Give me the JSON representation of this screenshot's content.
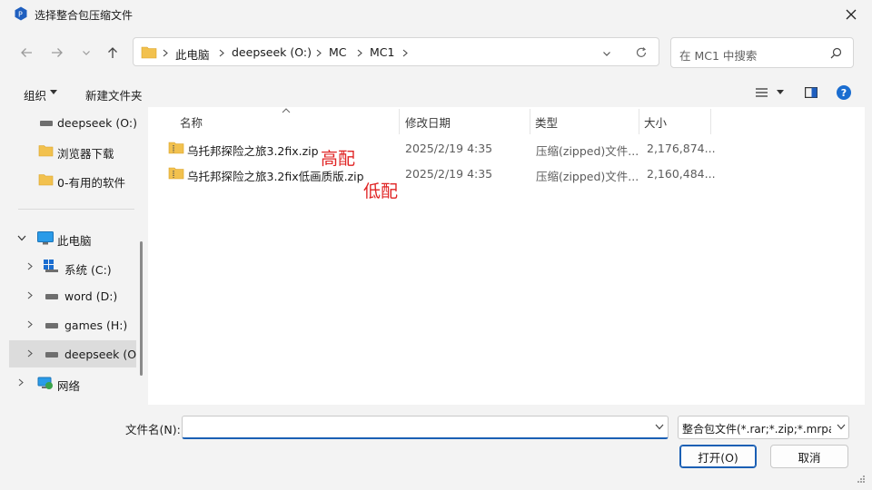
{
  "window": {
    "title": "选择整合包压缩文件"
  },
  "address": {
    "crumbs": [
      "此电脑",
      "deepseek (O:)",
      "MC",
      "MC1"
    ]
  },
  "search": {
    "placeholder": "在 MC1 中搜索"
  },
  "toolbar": {
    "organize": "组织",
    "new_folder": "新建文件夹"
  },
  "sidebar": {
    "items": [
      {
        "label": "deepseek (O:)"
      },
      {
        "label": "浏览器下载"
      },
      {
        "label": "0-有用的软件"
      },
      {
        "label": "此电脑"
      },
      {
        "label": "系统 (C:)"
      },
      {
        "label": "word (D:)"
      },
      {
        "label": "games (H:)"
      },
      {
        "label": "deepseek (O"
      },
      {
        "label": "网络"
      }
    ]
  },
  "columns": {
    "name": "名称",
    "modified": "修改日期",
    "type": "类型",
    "size": "大小"
  },
  "files": [
    {
      "name": "乌托邦探险之旅3.2fix.zip",
      "modified": "2025/2/19 4:35",
      "type": "压缩(zipped)文件...",
      "size": "2,176,874..."
    },
    {
      "name": "乌托邦探险之旅3.2fix低画质版.zip",
      "modified": "2025/2/19 4:35",
      "type": "压缩(zipped)文件...",
      "size": "2,160,484..."
    }
  ],
  "annotations": {
    "high": "高配",
    "low": "低配"
  },
  "footer": {
    "filename_label": "文件名(N):",
    "filename_value": "",
    "filter": "整合包文件(*.rar;*.zip;*.mrpac",
    "open": "打开(O)",
    "cancel": "取消"
  },
  "colors": {
    "accent": "#1a5fb4",
    "annotation": "#e02424",
    "folder": "#f2c14e"
  }
}
